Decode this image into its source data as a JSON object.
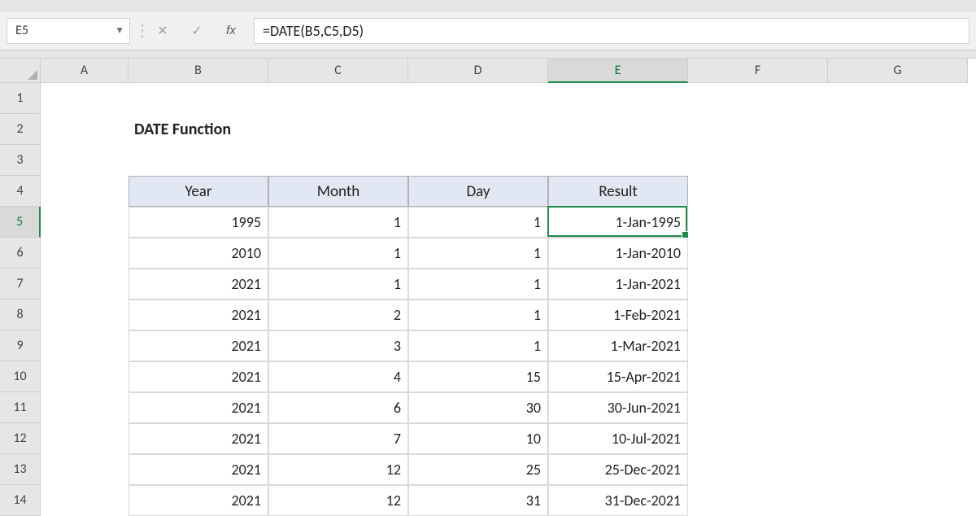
{
  "name_box": "E5",
  "formula": "=DATE(B5,C5,D5)",
  "columns": [
    "A",
    "B",
    "C",
    "D",
    "E",
    "F",
    "G"
  ],
  "rows": [
    "1",
    "2",
    "3",
    "4",
    "5",
    "6",
    "7",
    "8",
    "9",
    "10",
    "11",
    "12",
    "13",
    "14"
  ],
  "title": "DATE Function",
  "table": {
    "headers": [
      "Year",
      "Month",
      "Day",
      "Result"
    ],
    "rows": [
      {
        "year": "1995",
        "month": "1",
        "day": "1",
        "result": "1-Jan-1995"
      },
      {
        "year": "2010",
        "month": "1",
        "day": "1",
        "result": "1-Jan-2010"
      },
      {
        "year": "2021",
        "month": "1",
        "day": "1",
        "result": "1-Jan-2021"
      },
      {
        "year": "2021",
        "month": "2",
        "day": "1",
        "result": "1-Feb-2021"
      },
      {
        "year": "2021",
        "month": "3",
        "day": "1",
        "result": "1-Mar-2021"
      },
      {
        "year": "2021",
        "month": "4",
        "day": "15",
        "result": "15-Apr-2021"
      },
      {
        "year": "2021",
        "month": "6",
        "day": "30",
        "result": "30-Jun-2021"
      },
      {
        "year": "2021",
        "month": "7",
        "day": "10",
        "result": "10-Jul-2021"
      },
      {
        "year": "2021",
        "month": "12",
        "day": "25",
        "result": "25-Dec-2021"
      },
      {
        "year": "2021",
        "month": "12",
        "day": "31",
        "result": "31-Dec-2021"
      }
    ]
  },
  "active": {
    "col": "E",
    "row": "5"
  }
}
